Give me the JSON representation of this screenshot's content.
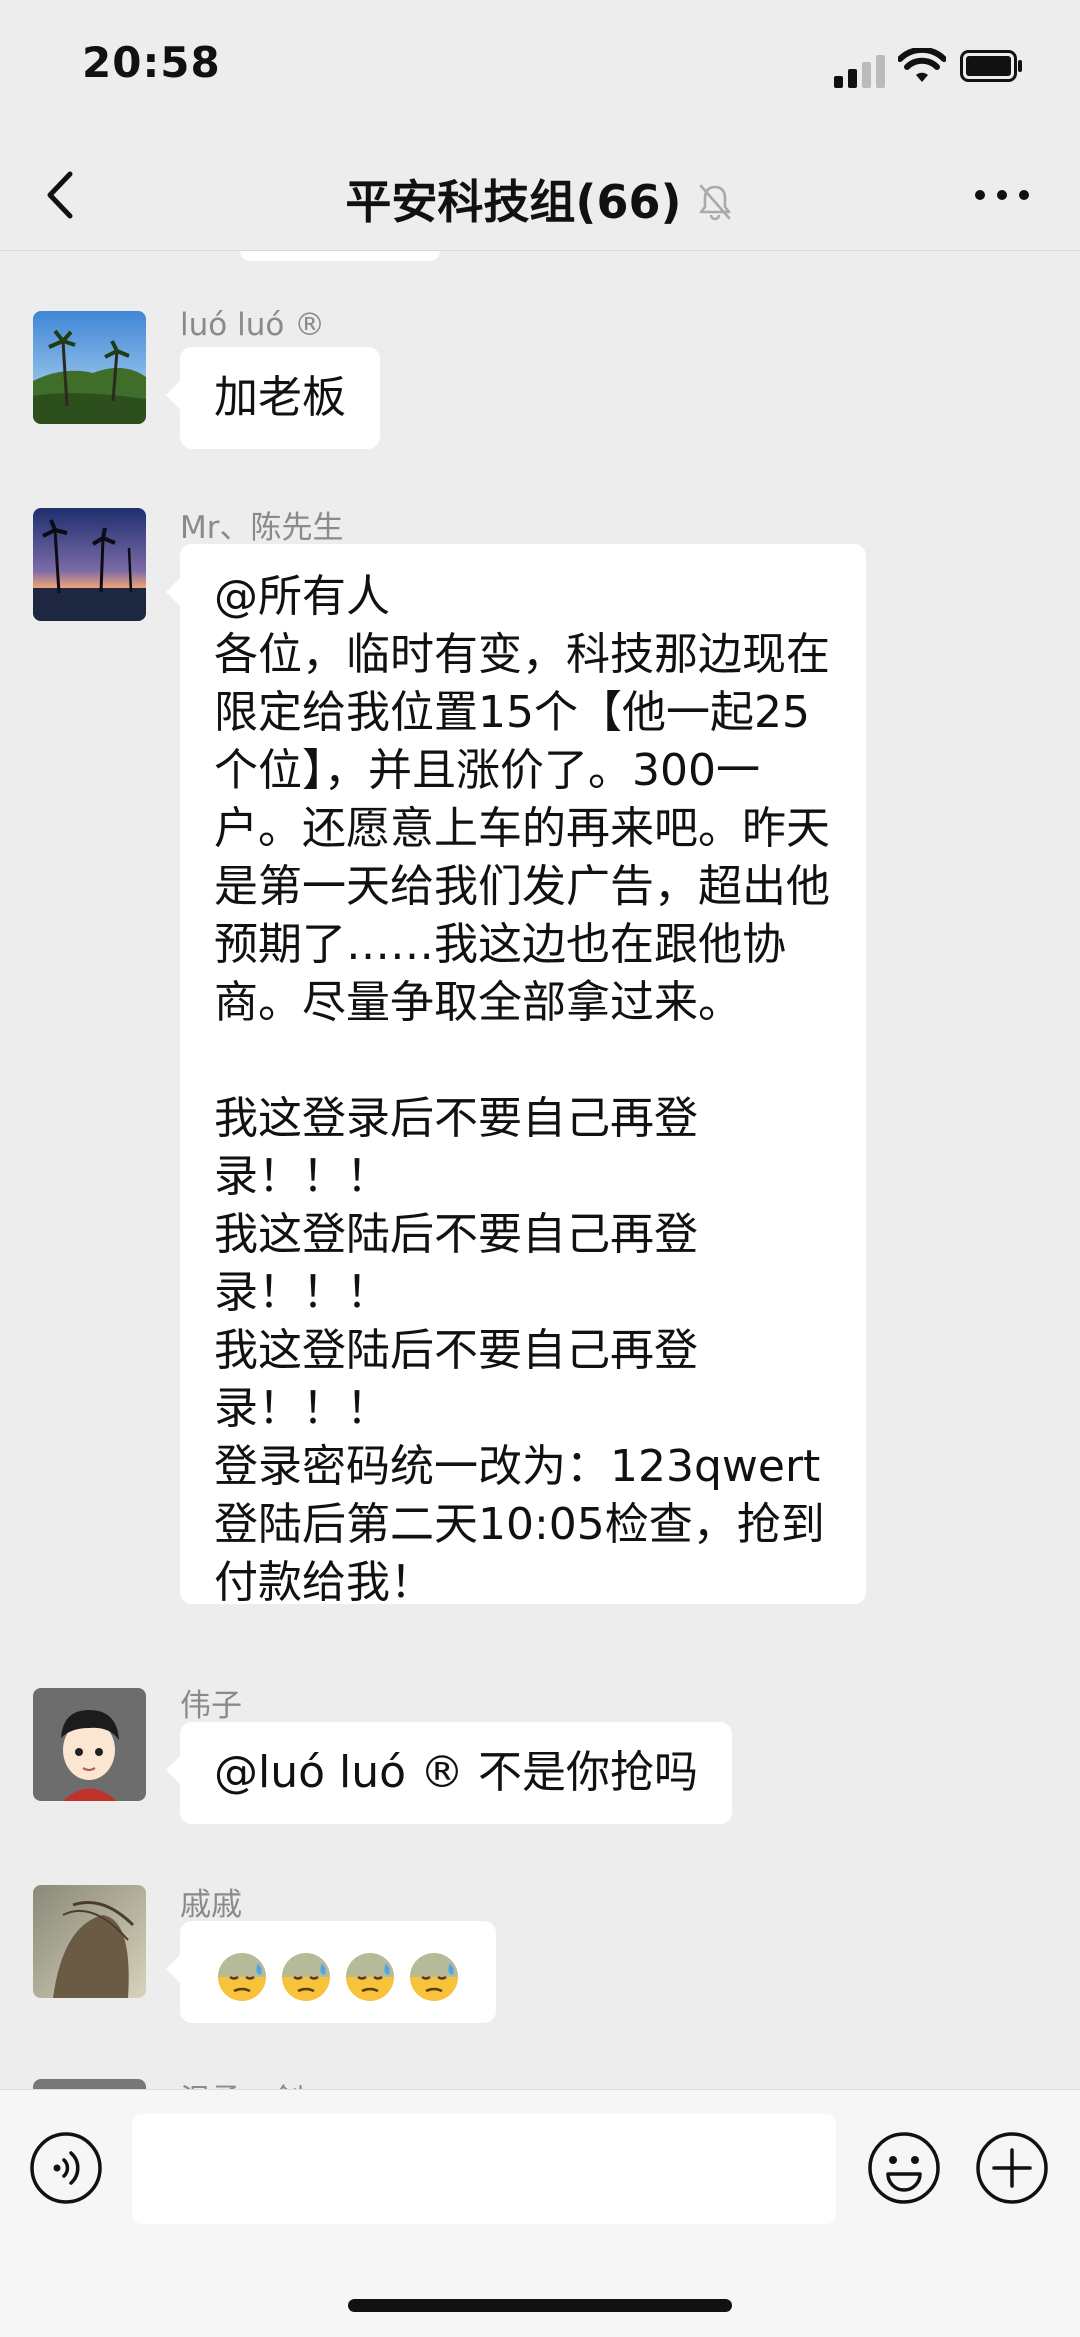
{
  "status_bar": {
    "time": "20:58"
  },
  "header": {
    "title": "平安科技组(66)"
  },
  "messages": [
    {
      "sender": "luó luó ®",
      "text": "加老板"
    },
    {
      "sender": "Mr、陈先生",
      "text": "@所有人\n各位，临时有变，科技那边现在限定给我位置15个【他一起25个位】，并且涨价了。300一户。还愿意上车的再来吧。昨天是第一天给我们发广告，超出他预期了……我这边也在跟他协商。尽量争取全部拿过来。\n\n我这登录后不要自己再登录！！！\n我这登陆后不要自己再登录！！！\n我这登陆后不要自己再登录！！！\n登录密码统一改为：123qwert\n登陆后第二天10:05检查，抢到付款给我！"
    },
    {
      "sender": "伟子",
      "text": "@luó luó ® 不是你抢吗"
    },
    {
      "sender": "戚戚",
      "emoji": [
        "😓",
        "😓",
        "😓",
        "😓"
      ]
    },
    {
      "sender": "温柔一剑"
    }
  ],
  "colors": {
    "background": "#ededed",
    "bubble": "#ffffff",
    "sender": "#8a8a8a",
    "text": "#111111"
  }
}
